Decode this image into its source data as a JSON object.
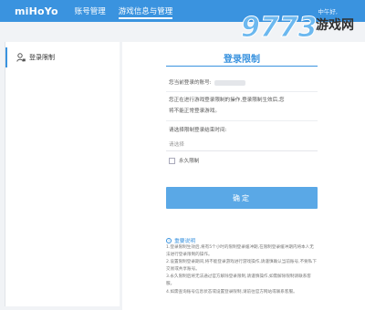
{
  "header": {
    "logo": "miHoYo",
    "nav": [
      "账号管理",
      "游戏信息与管理"
    ],
    "greeting": "中午好,"
  },
  "watermark": {
    "number": "9773",
    "text": "游戏网"
  },
  "sidebar": {
    "items": [
      {
        "label": "登录限制",
        "icon": "user-lock-icon"
      }
    ]
  },
  "main": {
    "title": "登录限制",
    "account_label": "您当前登录的账号:",
    "description": [
      "您正在进行游戏登录限制的操作,登录限制生效后,您",
      "将不能正常登录游戏。"
    ],
    "time_label": "请选择限制登录结束时间:",
    "time_placeholder": "请选择",
    "permanent_label": "永久限制",
    "confirm_label": "确定",
    "notes_title": "重要说明",
    "notes": [
      "1.登录限制生效后,将有5个小时的限制登录缓冲期,在限制登录缓冲期内将本人无法进行登录限制的操作。",
      "2.设置限制登录期间,将不能登录游戏进行游戏操作,请谨慎确认当前账号,不要私下交易或共享账号。",
      "3.永久限制后将无法通过官方解除登录限制,请谨慎操作,如需解除限制请联系客服。",
      "4.如需查询账号信息状态或设置登录限制,请前往官方网站或联系客服。"
    ]
  },
  "colors": {
    "accent": "#3a93df",
    "button": "#5aa8e6"
  }
}
